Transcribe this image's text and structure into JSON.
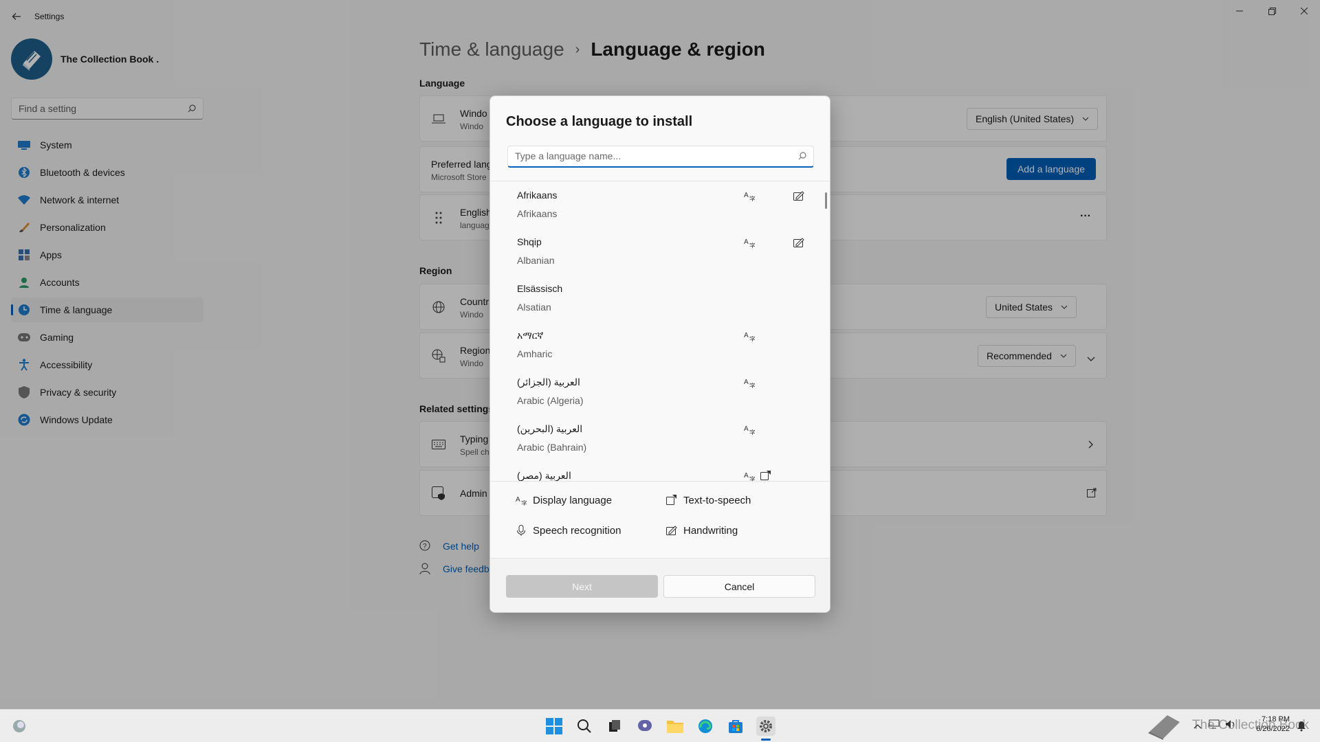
{
  "window": {
    "title": "Settings",
    "profile_name": "The Collection Book .",
    "search_placeholder": "Find a setting"
  },
  "sidebar": {
    "items": [
      {
        "label": "System",
        "icon": "monitor-icon"
      },
      {
        "label": "Bluetooth & devices",
        "icon": "bluetooth-icon"
      },
      {
        "label": "Network & internet",
        "icon": "wifi-icon"
      },
      {
        "label": "Personalization",
        "icon": "brush-icon"
      },
      {
        "label": "Apps",
        "icon": "apps-icon"
      },
      {
        "label": "Accounts",
        "icon": "person-icon"
      },
      {
        "label": "Time & language",
        "icon": "globe-clock-icon",
        "active": true
      },
      {
        "label": "Gaming",
        "icon": "gamepad-icon"
      },
      {
        "label": "Accessibility",
        "icon": "accessibility-icon"
      },
      {
        "label": "Privacy & security",
        "icon": "shield-icon"
      },
      {
        "label": "Windows Update",
        "icon": "update-icon"
      }
    ]
  },
  "main": {
    "breadcrumb_parent": "Time & language",
    "breadcrumb_sep": "›",
    "breadcrumb_current": "Language & region",
    "language_section": "Language",
    "display_card_title": "Windo",
    "display_card_sub": "Windo",
    "display_language_value": "English (United States)",
    "preferred_title": "Preferred lang",
    "preferred_sub": "Microsoft Store",
    "add_language_label": "Add a language",
    "english_title": "English",
    "english_sub": "languag",
    "more_label": "···",
    "region_section": "Region",
    "country_title": "Countr",
    "country_sub": "Windo",
    "country_value": "United States",
    "format_title": "Region",
    "format_sub": "Windo",
    "format_value": "Recommended",
    "related_section": "Related settings",
    "typing_title": "Typing",
    "typing_sub": "Spell ch",
    "admin_title": "Admin",
    "get_help": "Get help",
    "give_feedback": "Give feedb"
  },
  "dialog": {
    "title": "Choose a language to install",
    "search_placeholder": "Type a language name...",
    "languages": [
      {
        "native": "Afrikaans",
        "english": "Afrikaans",
        "display": true,
        "handwriting": true
      },
      {
        "native": "Shqip",
        "english": "Albanian",
        "display": true,
        "handwriting": true
      },
      {
        "native": "Elsässisch",
        "english": "Alsatian"
      },
      {
        "native": "አማርኛ",
        "english": "Amharic",
        "display": true
      },
      {
        "native": "العربية (الجزائر)",
        "english": "Arabic (Algeria)",
        "display": true
      },
      {
        "native": "العربية (البحرين)",
        "english": "Arabic (Bahrain)",
        "display": true
      },
      {
        "native": "العربية (مصر)",
        "english": "",
        "display": true,
        "tts": true
      }
    ],
    "legend": {
      "display_language": "Display language",
      "text_to_speech": "Text-to-speech",
      "speech_recognition": "Speech recognition",
      "handwriting": "Handwriting"
    },
    "next_label": "Next",
    "cancel_label": "Cancel"
  },
  "taskbar": {
    "time": "7:18 PM",
    "date": "6/26/2022",
    "watermark": "The Collection Book"
  },
  "colors": {
    "accent": "#005fb8",
    "background": "#f3f3f3"
  }
}
